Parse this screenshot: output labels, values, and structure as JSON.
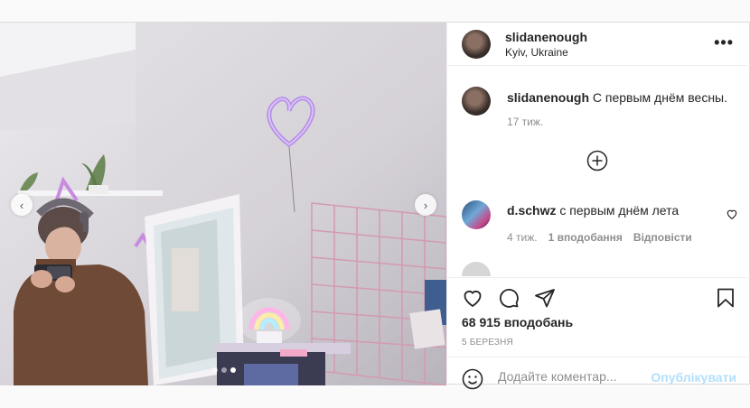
{
  "post": {
    "username": "slidanenough",
    "location": "Kyiv, Ukraine",
    "more_label": "•••",
    "carousel_prev": "‹",
    "carousel_next": "›",
    "carousel_pages": 3,
    "carousel_active": 3
  },
  "caption": {
    "username": "slidanenough",
    "text": "С первым днём весны.",
    "time": "17 тиж."
  },
  "comments": [
    {
      "username": "d.schwz",
      "text": "с первым днём лета",
      "time": "4 тиж.",
      "likes": "1 вподобання",
      "reply": "Відповісти"
    },
    {
      "username": "",
      "text": "",
      "partially_visible": true
    }
  ],
  "stats": {
    "likes": "68 915 вподобань",
    "date": "5 БЕРЕЗНЯ"
  },
  "add_comment": {
    "placeholder": "Додайте коментар...",
    "post_label": "Опублікувати"
  },
  "icons": [
    "more-icon",
    "load-more-icon",
    "heart-icon",
    "comment-icon",
    "share-icon",
    "save-icon",
    "emoji-icon"
  ],
  "colors": {
    "accent_disabled": "#b2dffc",
    "muted": "#8e8e8e",
    "text": "#262626",
    "border": "#dbdbdb"
  }
}
